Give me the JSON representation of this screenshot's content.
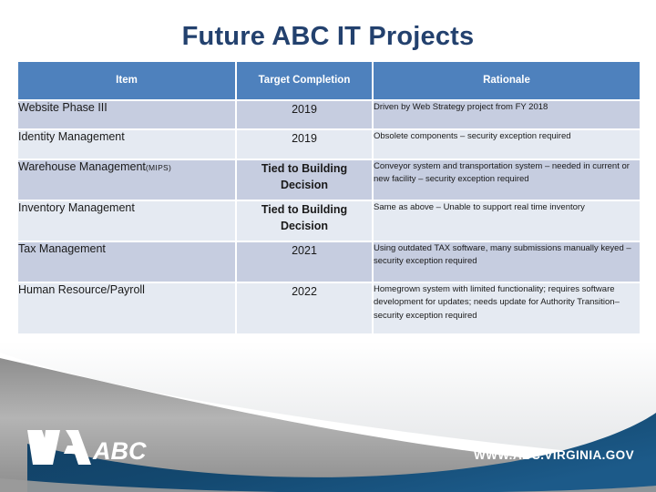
{
  "slide": {
    "title": "Future ABC IT Projects",
    "title_color": "#23416E"
  },
  "table": {
    "header_bg": "#4E81BD",
    "band_dark": "#C6CDE0",
    "band_light": "#E5EAF2",
    "columns": [
      {
        "label": "Item"
      },
      {
        "label": "Target Completion"
      },
      {
        "label": "Rationale"
      }
    ],
    "rows": [
      {
        "item": "Website Phase III",
        "item_sub": "",
        "target": "2019",
        "target_strong": false,
        "rationale": "Driven by Web Strategy project from FY 2018"
      },
      {
        "item": "Identity Management",
        "item_sub": "",
        "target": "2019",
        "target_strong": false,
        "rationale": "Obsolete components – security exception required"
      },
      {
        "item": "Warehouse Management",
        "item_sub": "(MIPS)",
        "target": "Tied to Building Decision",
        "target_strong": true,
        "rationale": "Conveyor system and transportation system – needed in current or new facility – security exception required"
      },
      {
        "item": "Inventory Management",
        "item_sub": "",
        "target": "Tied to Building Decision",
        "target_strong": true,
        "rationale": "Same as above – Unable to support real time inventory"
      },
      {
        "item": "Tax Management",
        "item_sub": "",
        "target": "2021",
        "target_strong": false,
        "rationale": "Using outdated TAX software, many submissions manually keyed – security exception required"
      },
      {
        "item": "Human Resource/Payroll",
        "item_sub": "",
        "target": "2022",
        "target_strong": false,
        "rationale": "Homegrown system with limited functionality; requires software development for updates; needs update for Authority Transition– security exception required"
      }
    ]
  },
  "footer": {
    "url": "WWW.ABC.VIRGINIA.GOV",
    "logo_text": "ABC",
    "logo_monogram": "VA",
    "swoosh_color": "#12456F",
    "gray_color": "#9A9A9A"
  }
}
